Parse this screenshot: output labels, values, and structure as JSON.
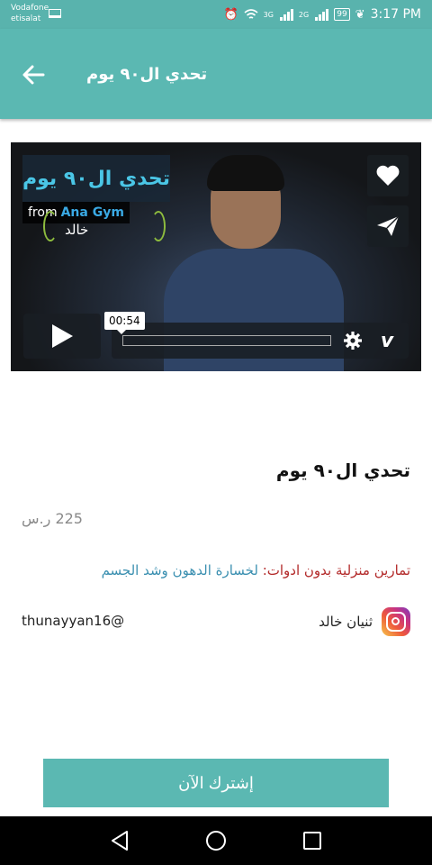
{
  "status_bar": {
    "carrier_line1": "Vodafone",
    "carrier_line2": "etisalat",
    "battery": "99",
    "time": "3:17 PM",
    "network_1": "3G",
    "network_2": "2G"
  },
  "app_bar": {
    "title": "تحدي ال٩٠ يوم",
    "back_icon": "arrow-left-icon"
  },
  "video": {
    "overlay_title": "تحدي ال٩٠ يوم",
    "from_label": "from",
    "from_brand": "Ana Gym",
    "logo_name": "خالد",
    "timestamp": "00:54",
    "vimeo_label": "v"
  },
  "course": {
    "title": "تحدي ال٩٠ يوم",
    "price": "225 ر.س",
    "desc_label": "تمارين منزلية بدون ادوات:",
    "desc_value": "لخسارة الدهون وشد الجسم"
  },
  "instagram": {
    "handle": "thunayyan16@",
    "name": "ثنيان خالد"
  },
  "actions": {
    "subscribe_label": "إشترك الآن"
  },
  "colors": {
    "primary": "#5bb8b2",
    "accent_red": "#b32a2a",
    "accent_blue": "#3a8fb0"
  }
}
